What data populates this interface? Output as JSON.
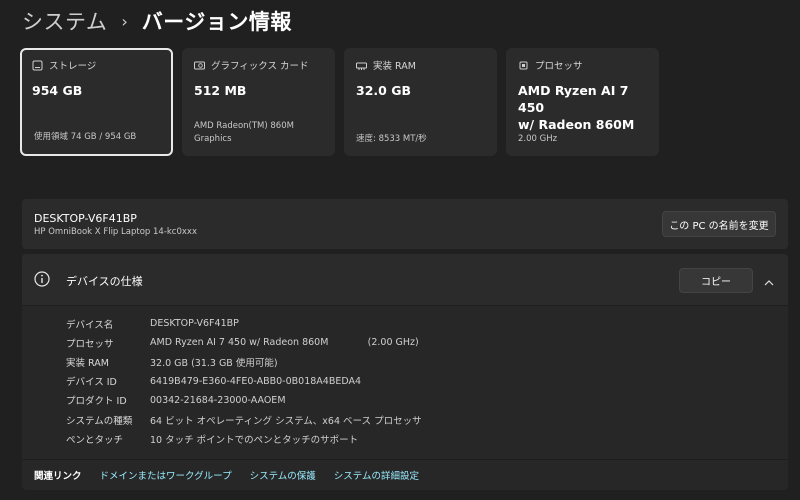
{
  "breadcrumb": {
    "parent": "システム",
    "separator": "›",
    "current": "バージョン情報"
  },
  "cards": [
    {
      "icon": "storage-icon",
      "label": "ストレージ",
      "value": "954 GB",
      "sub": "使用領域 74 GB / 954 GB",
      "selected": true
    },
    {
      "icon": "graphics-card-icon",
      "label": "グラフィックス カード",
      "value": "512 MB",
      "sub": "AMD Radeon(TM) 860M\nGraphics",
      "selected": false
    },
    {
      "icon": "ram-icon",
      "label": "実装 RAM",
      "value": "32.0 GB",
      "sub": "速度: 8533 MT/秒",
      "selected": false
    },
    {
      "icon": "processor-icon",
      "label": "プロセッサ",
      "value": "AMD Ryzen AI 7 450\nw/ Radeon 860M",
      "sub": "2.00 GHz",
      "selected": false
    }
  ],
  "device": {
    "name": "DESKTOP-V6F41BP",
    "model": "HP OmniBook X Flip Laptop 14-kc0xxx",
    "rename_label": "この PC の名前を変更"
  },
  "specs": {
    "title": "デバイスの仕様",
    "copy_label": "コピー",
    "rows": [
      {
        "key": "デバイス名",
        "value": "DESKTOP-V6F41BP"
      },
      {
        "key": "プロセッサ",
        "value": "AMD Ryzen AI 7 450 w/ Radeon 860M             (2.00 GHz)"
      },
      {
        "key": "実装 RAM",
        "value": "32.0 GB (31.3 GB 使用可能)"
      },
      {
        "key": "デバイス ID",
        "value": "6419B479-E360-4FE0-ABB0-0B018A4BEDA4"
      },
      {
        "key": "プロダクト ID",
        "value": "00342-21684-23000-AAOEM"
      },
      {
        "key": "システムの種類",
        "value": "64 ビット オペレーティング システム、x64 ベース プロセッサ"
      },
      {
        "key": "ペンとタッチ",
        "value": "10 タッチ ポイントでのペンとタッチのサポート"
      }
    ]
  },
  "related": {
    "label": "関連リンク",
    "links": [
      "ドメインまたはワークグループ",
      "システムの保護",
      "システムの詳細設定"
    ]
  },
  "colors": {
    "background": "#202020",
    "card": "#2b2b2b",
    "link": "#99ebff"
  }
}
